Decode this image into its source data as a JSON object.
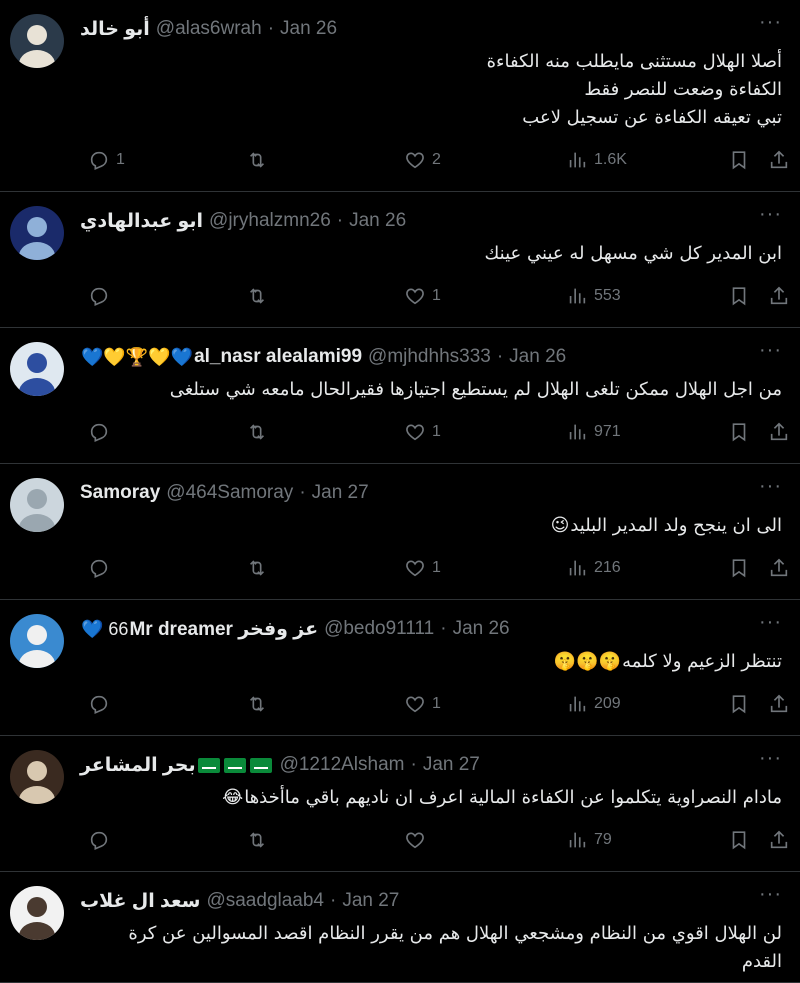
{
  "ui": {
    "more_glyph": "···"
  },
  "tweets": [
    {
      "name": "أبو خالد",
      "handle": "@alas6wrah",
      "date": "Jan 26",
      "lines": [
        "أصلا الهلال مستثنى مايطلب منه الكفاءة",
        "الكفاءة وضعت للنصر فقط",
        "تبي تعيقه الكفاءة عن تسجيل لاعب"
      ],
      "replies": "1",
      "retweets": "",
      "likes": "2",
      "views": "1.6K",
      "avatar_colors": [
        "#2b3a4a",
        "#e8e2d6"
      ]
    },
    {
      "name": "ابو عبدالهادي",
      "handle": "@jryhalzmn26",
      "date": "Jan 26",
      "lines": [
        "ابن المدير كل شي مسهل له عيني عينك"
      ],
      "replies": "",
      "retweets": "",
      "likes": "1",
      "views": "553",
      "avatar_colors": [
        "#1a2a6a",
        "#8fb0d8"
      ]
    },
    {
      "name": "al_nasr alealami99",
      "name_emojis": "💙💛🏆💛💙",
      "handle": "@mjhdhhs333",
      "date": "Jan 26",
      "lines": [
        "من اجل الهلال ممكن تلغى الهلال لم يستطيع اجتيازها فقيرالحال مامعه شي ستلغى"
      ],
      "replies": "",
      "retweets": "",
      "likes": "1",
      "views": "971",
      "avatar_colors": [
        "#dfe8f0",
        "#2d4ea0"
      ]
    },
    {
      "name": "Samoray",
      "handle": "@464Samoray",
      "date": "Jan 27",
      "lines": [
        "الى ان ينجح ولد المدير البليد"
      ],
      "line_emoji": "😉",
      "replies": "",
      "retweets": "",
      "likes": "1",
      "views": "216",
      "avatar_colors": [
        "#ccd6dd",
        "#9aa7b0"
      ]
    },
    {
      "name": "Mr dreamer عز وفخر",
      "name_emojis": "💙 66",
      "handle": "@bedo91111",
      "date": "Jan 26",
      "lines": [
        "تنتظر الزعيم ولا كلمه"
      ],
      "line_emoji": "🤫🤫🤫",
      "replies": "",
      "retweets": "",
      "likes": "1",
      "views": "209",
      "avatar_colors": [
        "#3a8ad0",
        "#f0f0f0"
      ]
    },
    {
      "name": "بحر المشاعر",
      "handle": "@1212Alsham",
      "date": "Jan 27",
      "lines": [
        "مادام النصراوية يتكلموا عن الكفاءة المالية اعرف ان ناديهم باقي ماأخذها"
      ],
      "line_emoji": "😂",
      "replies": "",
      "retweets": "",
      "likes": "",
      "views": "79",
      "avatar_colors": [
        "#3a2a20",
        "#d8c8b0"
      ]
    },
    {
      "name": "سعد ال غلاب",
      "handle": "@saadglaab4",
      "date": "Jan 27",
      "lines": [
        "لن الهلال اقوي من النظام ومشجعي الهلال هم من يقرر النظام اقصد المسوالين عن كرة",
        "القدم"
      ],
      "replies": "",
      "retweets": "",
      "likes": "",
      "views": "",
      "avatar_colors": [
        "#f2f2f2",
        "#4a3a30"
      ]
    }
  ]
}
